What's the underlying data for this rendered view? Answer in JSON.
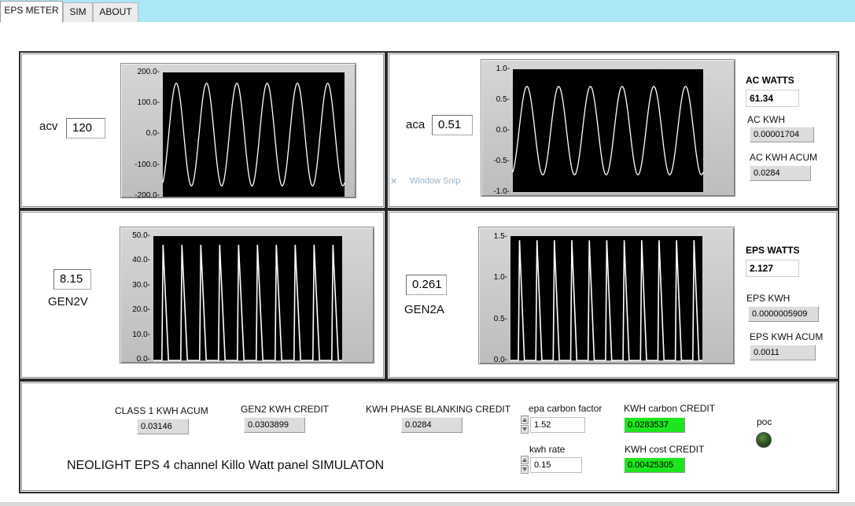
{
  "tabs": [
    {
      "label": "EPS METER",
      "active": true
    },
    {
      "label": "SIM",
      "active": false
    },
    {
      "label": "ABOUT",
      "active": false
    }
  ],
  "panel_acv": {
    "label": "acv",
    "value": "120",
    "yticks": [
      "200.0-",
      "100.0-",
      "0.0-",
      "-100.0-",
      "-200.0-"
    ],
    "y_range": [
      -200,
      200
    ],
    "amplitude": 165,
    "cycles": 6
  },
  "panel_aca": {
    "label": "aca",
    "value": "0.51",
    "yticks": [
      "1.0-",
      "0.5-",
      "0.0-",
      "-0.5-",
      "-1.0-"
    ],
    "y_range": [
      -1,
      1
    ],
    "amplitude": 0.72,
    "cycles": 6,
    "watts_label": "AC WATTS",
    "watts_value": "61.34",
    "kwh_label": "AC KWH",
    "kwh_value": "0.00001704",
    "kwh_acum_label": "AC KWH ACUM",
    "kwh_acum_value": "0.0284"
  },
  "panel_gen2v": {
    "label": "GEN2V",
    "value": "8.15",
    "yticks": [
      "50.0-",
      "40.0-",
      "30.0-",
      "20.0-",
      "10.0-",
      "0.0-"
    ],
    "y_range": [
      0,
      50
    ],
    "peak": 46.5,
    "pulses": 10
  },
  "panel_gen2a": {
    "label": "GEN2A",
    "value": "0.261",
    "yticks": [
      "1.5-",
      "1.0-",
      "0.5-",
      "0.0-"
    ],
    "y_range": [
      0,
      1.5
    ],
    "peak": 1.45,
    "pulses": 11,
    "watts_label": "EPS WATTS",
    "watts_value": "2.127",
    "kwh_label": "EPS KWH",
    "kwh_value": "0.0000005909",
    "kwh_acum_label": "EPS KWH ACUM",
    "kwh_acum_value": "0.0011"
  },
  "bottom": {
    "class1_label": "CLASS 1  KWH ACUM",
    "class1_value": "0.03146",
    "gen2_credit_label": "GEN2 KWH CREDIT",
    "gen2_credit_value": "0.0303899",
    "phase_label": "KWH PHASE BLANKING CREDIT",
    "phase_value": "0.0284",
    "epa_label": "epa carbon factor",
    "epa_value": "1.52",
    "kwh_rate_label": "kwh rate",
    "kwh_rate_value": "0.15",
    "carbon_credit_label": "KWH carbon CREDIT",
    "carbon_credit_value": "0.0283537",
    "cost_credit_label": "KWH cost CREDIT",
    "cost_credit_value": "0.00425305",
    "poc_label": "poc",
    "title": "NEOLIGHT EPS 4 channel Killo Watt panel SIMULATON"
  },
  "overlay": {
    "snip_text": "Window Snip"
  },
  "colors": {
    "topbar": "#aae8f8",
    "plot_bg": "#000000",
    "trace": "#ffffff",
    "green_readout": "#1ee61e",
    "led_off": "#2a4f22"
  }
}
